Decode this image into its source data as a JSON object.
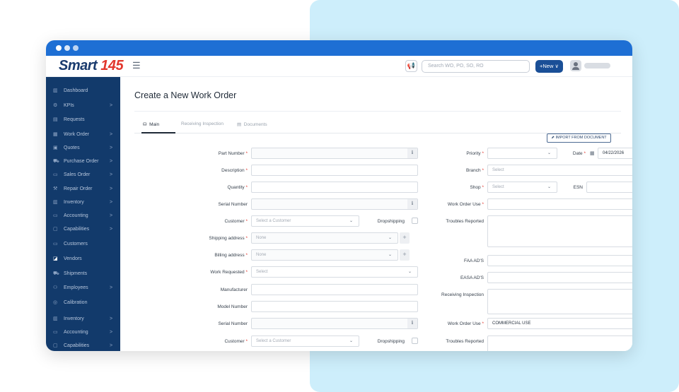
{
  "header": {
    "logo_text": "Smart ",
    "logo_number": "145",
    "search_placeholder": "Search WO, PO, SO, RO",
    "new_button": "+New ∨"
  },
  "sidebar": {
    "items": [
      {
        "label": "Dashboard",
        "icon": "chart-icon",
        "chevron": ""
      },
      {
        "label": "KPIs",
        "icon": "kpi-icon",
        "chevron": ">"
      },
      {
        "label": "Requests",
        "icon": "document-icon",
        "chevron": ""
      },
      {
        "label": "Work Order",
        "icon": "list-icon",
        "chevron": ">"
      },
      {
        "label": "Quotes",
        "icon": "quote-icon",
        "chevron": ">"
      },
      {
        "label": "Purchase Order",
        "icon": "cart-icon",
        "chevron": ">"
      },
      {
        "label": "Sales Order",
        "icon": "card-icon",
        "chevron": ">"
      },
      {
        "label": "Repair Order",
        "icon": "repair-icon",
        "chevron": ">"
      },
      {
        "label": "Inventory",
        "icon": "inventory-icon",
        "chevron": ">"
      },
      {
        "label": "Accounting",
        "icon": "accounting-icon",
        "chevron": ">"
      },
      {
        "label": "Capabilities",
        "icon": "capabilities-icon",
        "chevron": ">"
      },
      {
        "label": "Customers",
        "icon": "customers-icon",
        "chevron": ""
      },
      {
        "label": "Vendors",
        "icon": "vendors-icon",
        "chevron": ""
      },
      {
        "label": "Shipments",
        "icon": "shipments-icon",
        "chevron": ""
      },
      {
        "label": "Employees",
        "icon": "employees-icon",
        "chevron": ">"
      },
      {
        "label": "Calibration",
        "icon": "calibration-icon",
        "chevron": ""
      },
      {
        "label": "Inventory",
        "icon": "inventory-icon",
        "chevron": ">"
      },
      {
        "label": "Accounting",
        "icon": "accounting-icon",
        "chevron": ">"
      },
      {
        "label": "Capabilities",
        "icon": "capabilities-icon",
        "chevron": ">"
      }
    ]
  },
  "page": {
    "title": "Create a New Work Order",
    "tabs": [
      "Main",
      "Receiving Inspection",
      "Documents"
    ],
    "import_button": "IMPORT FROM DOCUMENT"
  },
  "form_left": {
    "part_number": "Part Number",
    "description": "Description",
    "quantity": "Quantity",
    "serial_number": "Serial Number",
    "customer": "Customer",
    "customer_placeholder": "Select a Customer",
    "dropshipping": "Dropshipping",
    "shipping_address": "Shipping address",
    "shipping_value": "None",
    "billing_address": "Billing address",
    "billing_value": "None",
    "work_requested": "Work Requested",
    "work_requested_value": "Select",
    "manufacturer": "Manufacturer",
    "model_number": "Model Number",
    "serial_number_2": "Serial Number",
    "customer_2": "Customer",
    "customer_2_placeholder": "Select a Customer",
    "dropshipping_2": "Dropshipping"
  },
  "form_right": {
    "priority": "Priority",
    "date": "Date",
    "date_value": "04/22/2026",
    "branch": "Branch",
    "branch_value": "Select",
    "shop": "Shop",
    "shop_value": "Select",
    "esn": "ESN",
    "work_order_use": "Work Order Use",
    "troubles_reported": "Troubles Reported",
    "faa_ads": "FAA AD'S",
    "easa_ads": "EASA AD'S",
    "receiving_inspection": "Receiving Inspection",
    "work_order_use_2": "Work Order Use",
    "work_order_use_2_value": "COMMERCIAL USE",
    "troubles_reported_2": "Troubles Reported"
  },
  "colors": {
    "titlebar": "#1e6fd4",
    "sidebar": "#123a6b",
    "accent": "#1a4f97",
    "required": "#e2372d",
    "backdrop": "#cdeefb"
  }
}
